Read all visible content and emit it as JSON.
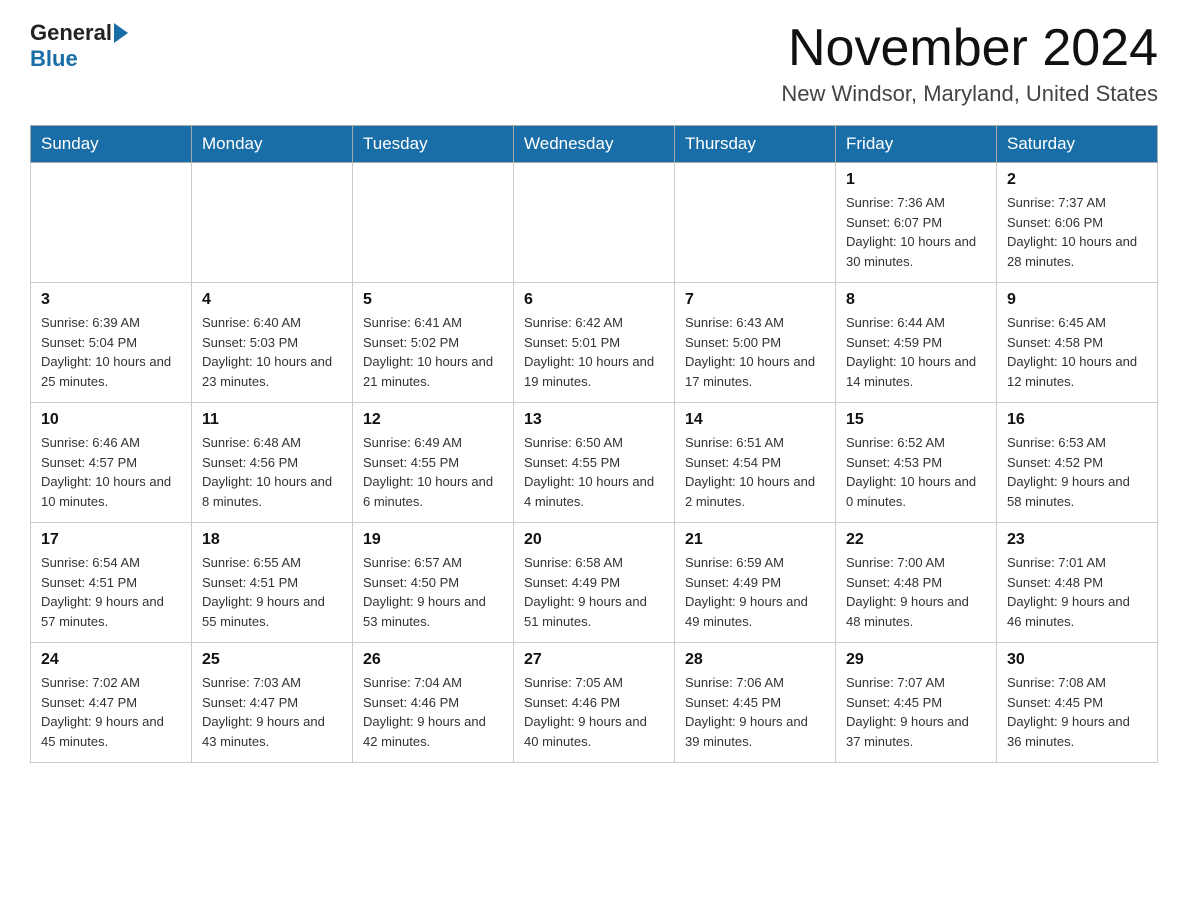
{
  "header": {
    "logo_general": "General",
    "logo_blue": "Blue",
    "title": "November 2024",
    "subtitle": "New Windsor, Maryland, United States"
  },
  "days_of_week": [
    "Sunday",
    "Monday",
    "Tuesday",
    "Wednesday",
    "Thursday",
    "Friday",
    "Saturday"
  ],
  "weeks": [
    [
      {
        "day": "",
        "sunrise": "",
        "sunset": "",
        "daylight": ""
      },
      {
        "day": "",
        "sunrise": "",
        "sunset": "",
        "daylight": ""
      },
      {
        "day": "",
        "sunrise": "",
        "sunset": "",
        "daylight": ""
      },
      {
        "day": "",
        "sunrise": "",
        "sunset": "",
        "daylight": ""
      },
      {
        "day": "",
        "sunrise": "",
        "sunset": "",
        "daylight": ""
      },
      {
        "day": "1",
        "sunrise": "Sunrise: 7:36 AM",
        "sunset": "Sunset: 6:07 PM",
        "daylight": "Daylight: 10 hours and 30 minutes."
      },
      {
        "day": "2",
        "sunrise": "Sunrise: 7:37 AM",
        "sunset": "Sunset: 6:06 PM",
        "daylight": "Daylight: 10 hours and 28 minutes."
      }
    ],
    [
      {
        "day": "3",
        "sunrise": "Sunrise: 6:39 AM",
        "sunset": "Sunset: 5:04 PM",
        "daylight": "Daylight: 10 hours and 25 minutes."
      },
      {
        "day": "4",
        "sunrise": "Sunrise: 6:40 AM",
        "sunset": "Sunset: 5:03 PM",
        "daylight": "Daylight: 10 hours and 23 minutes."
      },
      {
        "day": "5",
        "sunrise": "Sunrise: 6:41 AM",
        "sunset": "Sunset: 5:02 PM",
        "daylight": "Daylight: 10 hours and 21 minutes."
      },
      {
        "day": "6",
        "sunrise": "Sunrise: 6:42 AM",
        "sunset": "Sunset: 5:01 PM",
        "daylight": "Daylight: 10 hours and 19 minutes."
      },
      {
        "day": "7",
        "sunrise": "Sunrise: 6:43 AM",
        "sunset": "Sunset: 5:00 PM",
        "daylight": "Daylight: 10 hours and 17 minutes."
      },
      {
        "day": "8",
        "sunrise": "Sunrise: 6:44 AM",
        "sunset": "Sunset: 4:59 PM",
        "daylight": "Daylight: 10 hours and 14 minutes."
      },
      {
        "day": "9",
        "sunrise": "Sunrise: 6:45 AM",
        "sunset": "Sunset: 4:58 PM",
        "daylight": "Daylight: 10 hours and 12 minutes."
      }
    ],
    [
      {
        "day": "10",
        "sunrise": "Sunrise: 6:46 AM",
        "sunset": "Sunset: 4:57 PM",
        "daylight": "Daylight: 10 hours and 10 minutes."
      },
      {
        "day": "11",
        "sunrise": "Sunrise: 6:48 AM",
        "sunset": "Sunset: 4:56 PM",
        "daylight": "Daylight: 10 hours and 8 minutes."
      },
      {
        "day": "12",
        "sunrise": "Sunrise: 6:49 AM",
        "sunset": "Sunset: 4:55 PM",
        "daylight": "Daylight: 10 hours and 6 minutes."
      },
      {
        "day": "13",
        "sunrise": "Sunrise: 6:50 AM",
        "sunset": "Sunset: 4:55 PM",
        "daylight": "Daylight: 10 hours and 4 minutes."
      },
      {
        "day": "14",
        "sunrise": "Sunrise: 6:51 AM",
        "sunset": "Sunset: 4:54 PM",
        "daylight": "Daylight: 10 hours and 2 minutes."
      },
      {
        "day": "15",
        "sunrise": "Sunrise: 6:52 AM",
        "sunset": "Sunset: 4:53 PM",
        "daylight": "Daylight: 10 hours and 0 minutes."
      },
      {
        "day": "16",
        "sunrise": "Sunrise: 6:53 AM",
        "sunset": "Sunset: 4:52 PM",
        "daylight": "Daylight: 9 hours and 58 minutes."
      }
    ],
    [
      {
        "day": "17",
        "sunrise": "Sunrise: 6:54 AM",
        "sunset": "Sunset: 4:51 PM",
        "daylight": "Daylight: 9 hours and 57 minutes."
      },
      {
        "day": "18",
        "sunrise": "Sunrise: 6:55 AM",
        "sunset": "Sunset: 4:51 PM",
        "daylight": "Daylight: 9 hours and 55 minutes."
      },
      {
        "day": "19",
        "sunrise": "Sunrise: 6:57 AM",
        "sunset": "Sunset: 4:50 PM",
        "daylight": "Daylight: 9 hours and 53 minutes."
      },
      {
        "day": "20",
        "sunrise": "Sunrise: 6:58 AM",
        "sunset": "Sunset: 4:49 PM",
        "daylight": "Daylight: 9 hours and 51 minutes."
      },
      {
        "day": "21",
        "sunrise": "Sunrise: 6:59 AM",
        "sunset": "Sunset: 4:49 PM",
        "daylight": "Daylight: 9 hours and 49 minutes."
      },
      {
        "day": "22",
        "sunrise": "Sunrise: 7:00 AM",
        "sunset": "Sunset: 4:48 PM",
        "daylight": "Daylight: 9 hours and 48 minutes."
      },
      {
        "day": "23",
        "sunrise": "Sunrise: 7:01 AM",
        "sunset": "Sunset: 4:48 PM",
        "daylight": "Daylight: 9 hours and 46 minutes."
      }
    ],
    [
      {
        "day": "24",
        "sunrise": "Sunrise: 7:02 AM",
        "sunset": "Sunset: 4:47 PM",
        "daylight": "Daylight: 9 hours and 45 minutes."
      },
      {
        "day": "25",
        "sunrise": "Sunrise: 7:03 AM",
        "sunset": "Sunset: 4:47 PM",
        "daylight": "Daylight: 9 hours and 43 minutes."
      },
      {
        "day": "26",
        "sunrise": "Sunrise: 7:04 AM",
        "sunset": "Sunset: 4:46 PM",
        "daylight": "Daylight: 9 hours and 42 minutes."
      },
      {
        "day": "27",
        "sunrise": "Sunrise: 7:05 AM",
        "sunset": "Sunset: 4:46 PM",
        "daylight": "Daylight: 9 hours and 40 minutes."
      },
      {
        "day": "28",
        "sunrise": "Sunrise: 7:06 AM",
        "sunset": "Sunset: 4:45 PM",
        "daylight": "Daylight: 9 hours and 39 minutes."
      },
      {
        "day": "29",
        "sunrise": "Sunrise: 7:07 AM",
        "sunset": "Sunset: 4:45 PM",
        "daylight": "Daylight: 9 hours and 37 minutes."
      },
      {
        "day": "30",
        "sunrise": "Sunrise: 7:08 AM",
        "sunset": "Sunset: 4:45 PM",
        "daylight": "Daylight: 9 hours and 36 minutes."
      }
    ]
  ]
}
